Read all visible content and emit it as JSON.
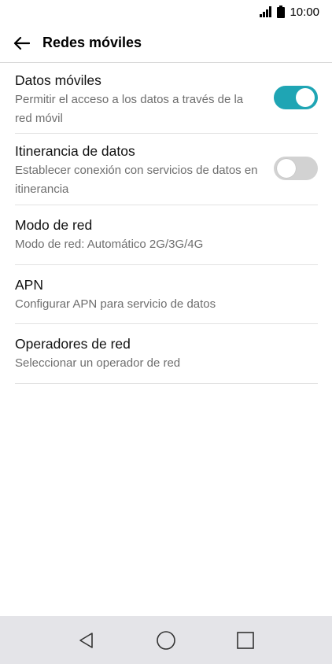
{
  "status": {
    "time": "10:00"
  },
  "header": {
    "title": "Redes móviles"
  },
  "items": [
    {
      "primary": "Datos móviles",
      "secondary": "Permitir el acceso a los datos a través de la red móvil",
      "toggle": true
    },
    {
      "primary": "Itinerancia de datos",
      "secondary": "Establecer conexión con servicios de datos en itinerancia",
      "toggle": false
    },
    {
      "primary": "Modo de red",
      "secondary": "Modo de red: Automático 2G/3G/4G"
    },
    {
      "primary": "APN",
      "secondary": "Configurar APN para servicio de datos"
    },
    {
      "primary": "Operadores de red",
      "secondary": "Seleccionar un operador de red"
    }
  ],
  "colors": {
    "accent": "#1fa5b4",
    "toggle_off": "#d2d2d2",
    "nav_bg": "#e4e4e8"
  }
}
